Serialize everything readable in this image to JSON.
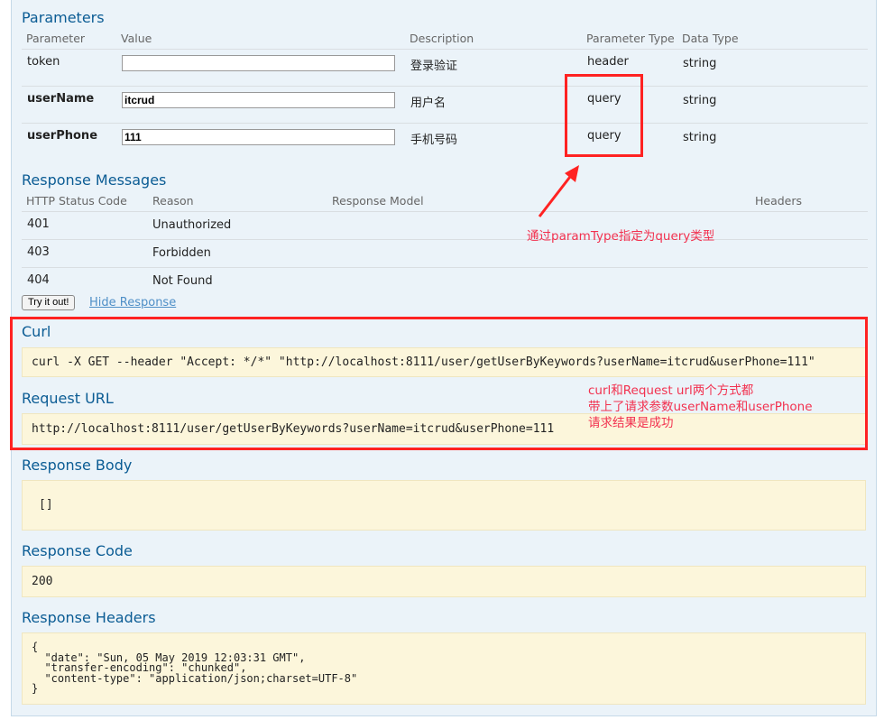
{
  "parameters": {
    "title": "Parameters",
    "headers": [
      "Parameter",
      "Value",
      "Description",
      "Parameter Type",
      "Data Type"
    ],
    "rows": [
      {
        "name": "token",
        "value": "",
        "description": "登录验证",
        "param_type": "header",
        "data_type": "string"
      },
      {
        "name": "userName",
        "value": "itcrud",
        "description": "用户名",
        "param_type": "query",
        "data_type": "string"
      },
      {
        "name": "userPhone",
        "value": "111",
        "description": "手机号码",
        "param_type": "query",
        "data_type": "string"
      }
    ]
  },
  "response_messages": {
    "title": "Response Messages",
    "headers": [
      "HTTP Status Code",
      "Reason",
      "Response Model",
      "Headers"
    ],
    "rows": [
      {
        "code": "401",
        "reason": "Unauthorized"
      },
      {
        "code": "403",
        "reason": "Forbidden"
      },
      {
        "code": "404",
        "reason": "Not Found"
      }
    ]
  },
  "actions": {
    "try_label": "Try it out!",
    "hide_label": "Hide Response"
  },
  "curl": {
    "title": "Curl",
    "command": "curl -X GET --header \"Accept: */*\" \"http://localhost:8111/user/getUserByKeywords?userName=itcrud&userPhone=111\""
  },
  "request_url": {
    "title": "Request URL",
    "url": "http://localhost:8111/user/getUserByKeywords?userName=itcrud&userPhone=111"
  },
  "response_body": {
    "title": "Response Body",
    "content": "[]"
  },
  "response_code": {
    "title": "Response Code",
    "content": "200"
  },
  "response_headers": {
    "title": "Response Headers",
    "content": "{\n  \"date\": \"Sun, 05 May 2019 12:03:31 GMT\",\n  \"transfer-encoding\": \"chunked\",\n  \"content-type\": \"application/json;charset=UTF-8\"\n}"
  },
  "annotations": {
    "param_type_note": "通过paramType指定为query类型",
    "curl_note_line1": "curl和Request url两个方式都",
    "curl_note_line2": "带上了请求参数userName和userPhone",
    "curl_note_line3": "请求结果是成功"
  },
  "colors": {
    "heading": "#0b5c94",
    "annotation_red": "#ff2222",
    "code_bg": "#fcf6db",
    "panel_bg": "#ebf3f9"
  }
}
